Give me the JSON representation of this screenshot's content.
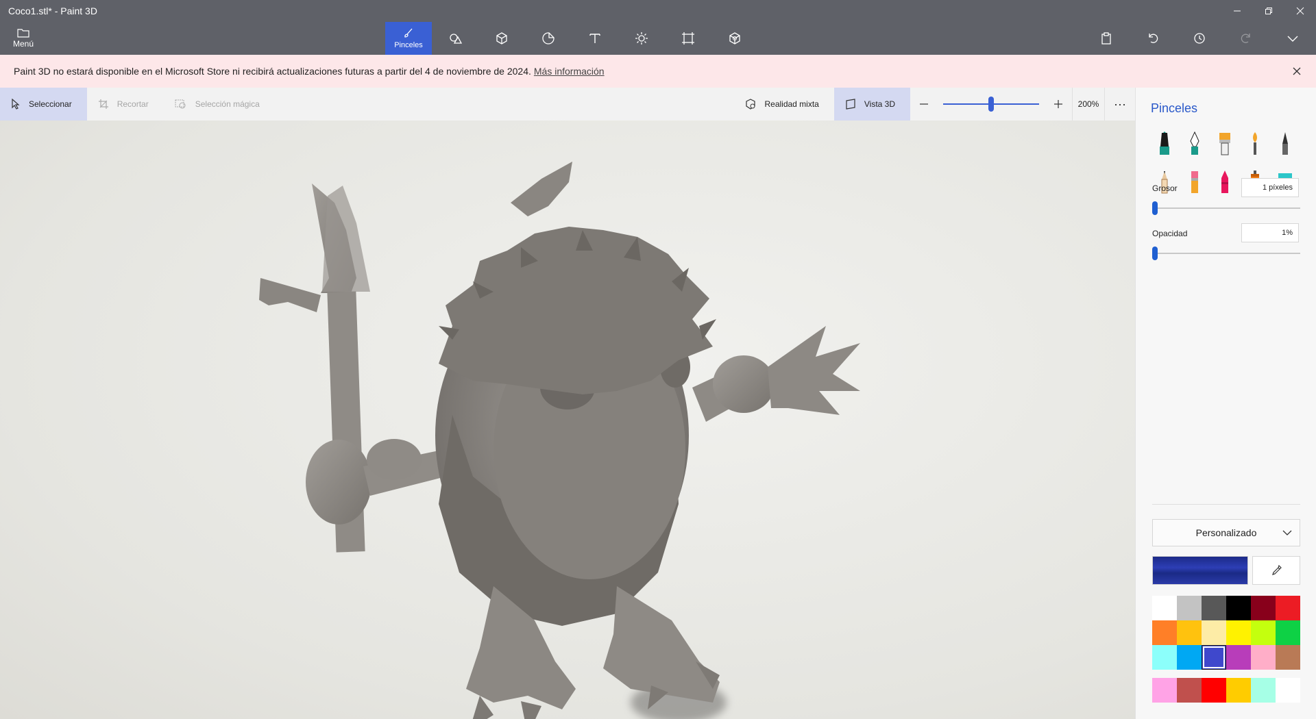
{
  "window": {
    "title": "Coco1.stl* - Paint 3D",
    "controls": [
      "minimize",
      "restore",
      "close"
    ]
  },
  "menu": {
    "label": "Menú"
  },
  "ribbon": {
    "tools": [
      {
        "name": "brushes",
        "label": "Pinceles",
        "icon": "brush-icon",
        "active": true
      },
      {
        "name": "2d-shapes",
        "label": "",
        "icon": "shapes-2d-icon"
      },
      {
        "name": "3d-shapes",
        "label": "",
        "icon": "cube-icon"
      },
      {
        "name": "stickers",
        "label": "",
        "icon": "sticker-icon"
      },
      {
        "name": "text",
        "label": "",
        "icon": "text-icon"
      },
      {
        "name": "effects",
        "label": "",
        "icon": "effects-icon"
      },
      {
        "name": "canvas",
        "label": "",
        "icon": "canvas-icon"
      },
      {
        "name": "3d-library",
        "label": "",
        "icon": "3d-library-icon"
      }
    ],
    "right_tools": [
      "paste-icon",
      "undo-icon",
      "history-icon",
      "redo-icon",
      "expand-icon"
    ]
  },
  "banner": {
    "text": "Paint 3D no estará disponible en el Microsoft Store ni recibirá actualizaciones futuras a partir del 4 de noviembre de 2024.",
    "link": "Más información"
  },
  "canvas_toolbar": {
    "select": "Seleccionar",
    "crop": "Recortar",
    "magic_select": "Selección mágica",
    "mixed_reality": "Realidad mixta",
    "view_3d": "Vista 3D",
    "zoom": "200%",
    "zoom_level": 0.5,
    "more": "···"
  },
  "panel": {
    "title": "Pinceles",
    "brushes": [
      "marker-icon",
      "calligraphy-pen-icon",
      "oil-brush-icon",
      "watercolor-icon",
      "pixel-pen-icon",
      "pencil-icon",
      "eraser-icon",
      "crayon-icon",
      "spray-can-icon",
      "fill-bucket-icon"
    ],
    "thickness": {
      "label": "Grosor",
      "value": "1 píxeles",
      "level": 0.0
    },
    "opacity": {
      "label": "Opacidad",
      "value": "1%",
      "level": 0.0
    },
    "palette": {
      "selected": "Personalizado"
    },
    "current_color": "#2a37a8",
    "swatches": [
      "#ffffff",
      "#c3c3c3",
      "#585858",
      "#000000",
      "#88001b",
      "#ec1c24",
      "#ff7f27",
      "#ffc20e",
      "#fdeca6",
      "#fff200",
      "#c4ff0e",
      "#0ed145",
      "#8cfffb",
      "#00a8f3",
      "#3f48cc",
      "#b83dba",
      "#ffaec8",
      "#b97a56"
    ],
    "selected_swatch": 14,
    "custom_swatches": [
      "#ffa3e6",
      "#c0504d",
      "#ff0000",
      "#ffcc00",
      "#a6ffe6",
      "#ffffff"
    ]
  }
}
